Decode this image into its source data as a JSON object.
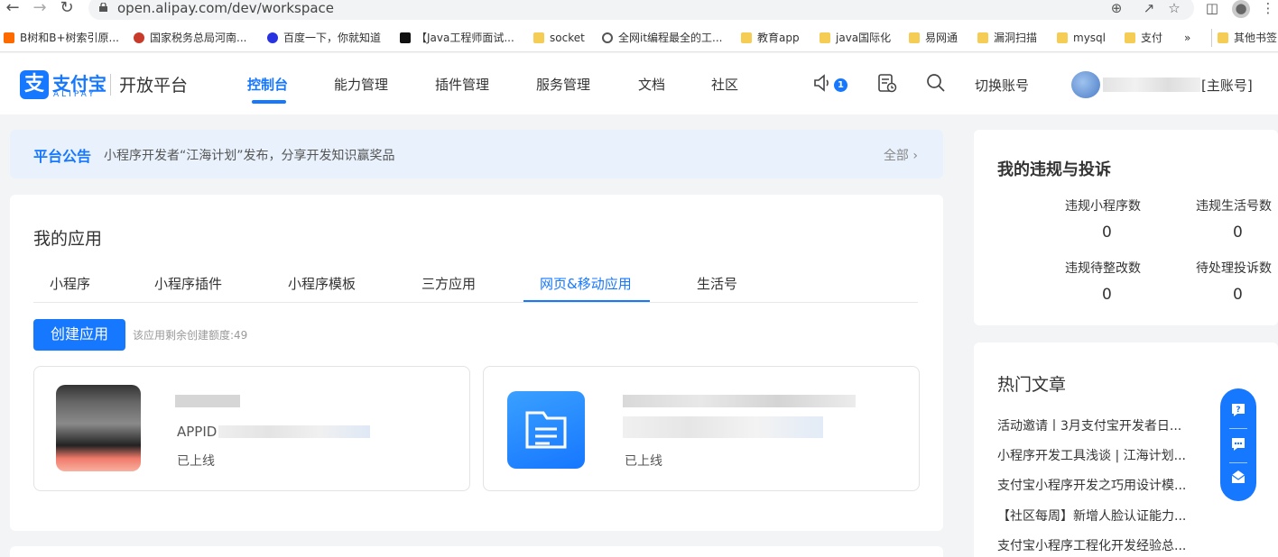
{
  "browser": {
    "url": "open.alipay.com/dev/workspace",
    "bookmarks": [
      "B树和B+树索引原...",
      "国家税务总局河南...",
      "百度一下，你就知道",
      "【Java工程师面试...",
      "socket",
      "全网it编程最全的工...",
      "教育app",
      "java国际化",
      "易网通",
      "漏洞扫描",
      "mysql",
      "支付",
      "»",
      "其他书签"
    ]
  },
  "header": {
    "logo_cn": "支付宝",
    "logo_en": "ALIPAY",
    "platform": "开放平台",
    "nav": [
      "控制台",
      "能力管理",
      "插件管理",
      "服务管理",
      "文档",
      "社区"
    ],
    "active_nav": "控制台",
    "notification_count": "1",
    "switch_account": "切换账号",
    "account_suffix": "[主账号]"
  },
  "notice": {
    "tag": "平台公告",
    "message": "小程序开发者“江海计划”发布，分享开发知识赢奖品",
    "all_link": "全部"
  },
  "apps": {
    "title": "我的应用",
    "tabs": [
      "小程序",
      "小程序插件",
      "小程序模板",
      "三方应用",
      "网页&移动应用",
      "生活号"
    ],
    "active_tab": "网页&移动应用",
    "create_button": "创建应用",
    "quota_text": "该应用剩余创建额度:49",
    "cards": [
      {
        "appid_prefix": "APPID",
        "status": "已上线"
      },
      {
        "status": "已上线"
      }
    ]
  },
  "violations": {
    "title": "我的违规与投诉",
    "stats": [
      {
        "label": "违规小程序数",
        "value": "0"
      },
      {
        "label": "违规生活号数",
        "value": "0"
      },
      {
        "label": "违规待整改数",
        "value": "0"
      },
      {
        "label": "待处理投诉数",
        "value": "0"
      }
    ]
  },
  "hot_articles": {
    "title": "热门文章",
    "items": [
      "活动邀请丨3月支付宝开发者日...",
      "小程序开发工具浅谈 | 江海计划...",
      "支付宝小程序开发之巧用设计模...",
      "【社区每周】新增人脸认证能力...",
      "支付宝小程序工程化开发经验总..."
    ]
  },
  "colors": {
    "brand": "#1677ff",
    "background": "#f3f4f6",
    "notice_bg": "#e8f1fc"
  }
}
